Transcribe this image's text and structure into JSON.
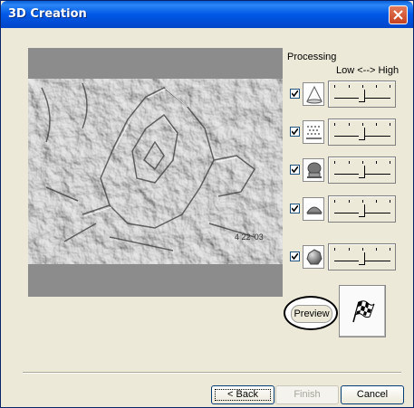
{
  "window": {
    "title": "3D Creation"
  },
  "processing": {
    "label": "Processing",
    "range_label": "Low <--> High",
    "rows": [
      {
        "icon": "cone-icon",
        "checked": true
      },
      {
        "icon": "texture-icon",
        "checked": true
      },
      {
        "icon": "bust-icon",
        "checked": true
      },
      {
        "icon": "dome-icon",
        "checked": true
      },
      {
        "icon": "sphere-icon",
        "checked": true
      }
    ]
  },
  "buttons": {
    "preview": "Preview",
    "back": "< Back",
    "finish": "Finish",
    "cancel": "Cancel"
  },
  "preview_image": {
    "stamp": "4 22 '03"
  }
}
